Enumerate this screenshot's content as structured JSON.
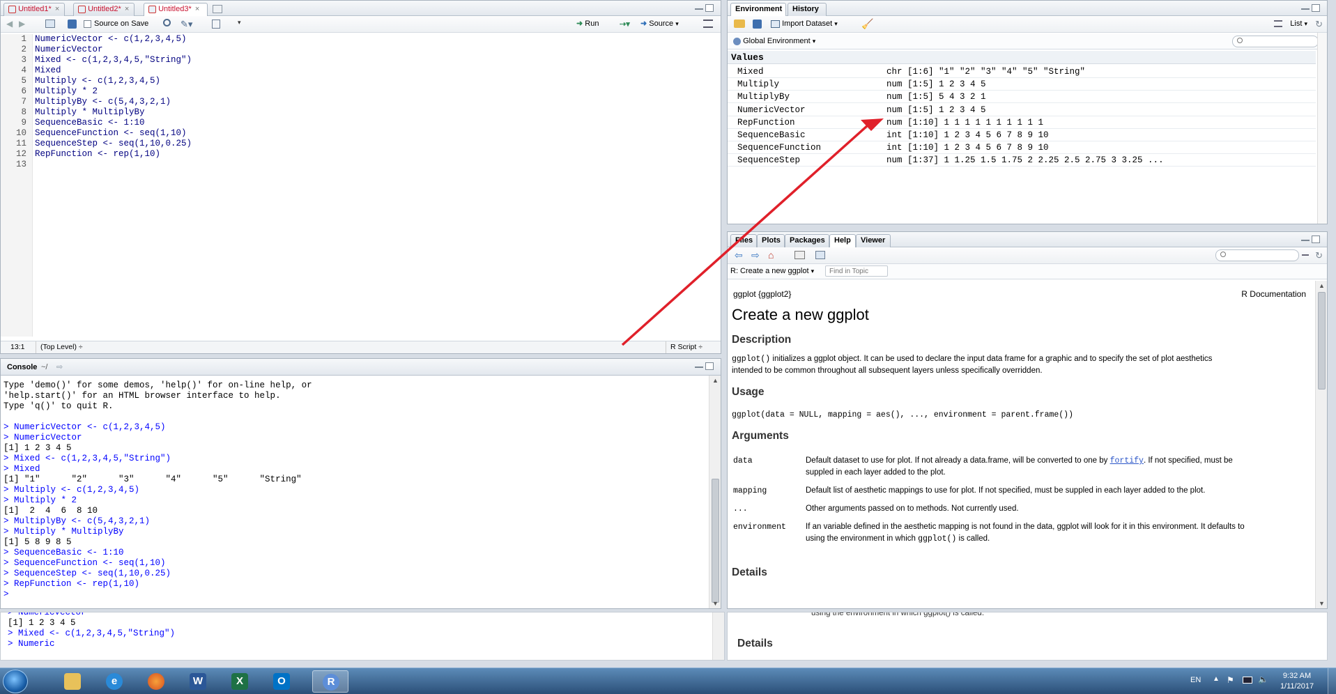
{
  "editor": {
    "tabs": [
      {
        "label": "Untitled1*"
      },
      {
        "label": "Untitled2*"
      },
      {
        "label": "Untitled3*"
      }
    ],
    "source_on_save": "Source on Save",
    "run_label": "Run",
    "source_label": "Source",
    "line_numbers": [
      "1",
      "2",
      "3",
      "4",
      "5",
      "6",
      "7",
      "8",
      "9",
      "10",
      "11",
      "12",
      "13"
    ],
    "lines": [
      "NumericVector <- c(1,2,3,4,5)",
      "NumericVector",
      "Mixed <- c(1,2,3,4,5,\"String\")",
      "Mixed",
      "Multiply <- c(1,2,3,4,5)",
      "Multiply * 2",
      "MultiplyBy <- c(5,4,3,2,1)",
      "Multiply * MultiplyBy",
      "SequenceBasic <- 1:10",
      "SequenceFunction <- seq(1,10)",
      "SequenceStep <- seq(1,10,0.25)",
      "RepFunction <- rep(1,10)",
      ""
    ],
    "status_pos": "13:1",
    "status_scope": "(Top Level) ÷",
    "status_type": "R Script ÷"
  },
  "console": {
    "title": "Console",
    "path": "~/",
    "lines": [
      {
        "t": "out",
        "s": "Type 'demo()' for some demos, 'help()' for on-line help, or"
      },
      {
        "t": "out",
        "s": "'help.start()' for an HTML browser interface to help."
      },
      {
        "t": "out",
        "s": "Type 'q()' to quit R."
      },
      {
        "t": "out",
        "s": ""
      },
      {
        "t": "in",
        "s": "> NumericVector <- c(1,2,3,4,5)"
      },
      {
        "t": "in",
        "s": "> NumericVector"
      },
      {
        "t": "out",
        "s": "[1] 1 2 3 4 5"
      },
      {
        "t": "in",
        "s": "> Mixed <- c(1,2,3,4,5,\"String\")"
      },
      {
        "t": "in",
        "s": "> Mixed"
      },
      {
        "t": "out",
        "s": "[1] \"1\"      \"2\"      \"3\"      \"4\"      \"5\"      \"String\""
      },
      {
        "t": "in",
        "s": "> Multiply <- c(1,2,3,4,5)"
      },
      {
        "t": "in",
        "s": "> Multiply * 2"
      },
      {
        "t": "out",
        "s": "[1]  2  4  6  8 10"
      },
      {
        "t": "in",
        "s": "> MultiplyBy <- c(5,4,3,2,1)"
      },
      {
        "t": "in",
        "s": "> Multiply * MultiplyBy"
      },
      {
        "t": "out",
        "s": "[1] 5 8 9 8 5"
      },
      {
        "t": "in",
        "s": "> SequenceBasic <- 1:10"
      },
      {
        "t": "in",
        "s": "> SequenceFunction <- seq(1,10)"
      },
      {
        "t": "in",
        "s": "> SequenceStep <- seq(1,10,0.25)"
      },
      {
        "t": "in",
        "s": "> RepFunction <- rep(1,10)"
      },
      {
        "t": "in",
        "s": "> "
      }
    ]
  },
  "ghost_console": [
    "> NumericVector",
    "[1] 1 2 3 4 5",
    "> Mixed <- c(1,2,3,4,5,\"String\")",
    "> Numeric"
  ],
  "environment": {
    "tabs": [
      "Environment",
      "History"
    ],
    "import_label": "Import Dataset",
    "view_label": "List",
    "scope_label": "Global Environment",
    "section": "Values",
    "rows": [
      {
        "name": "Mixed",
        "value": "chr [1:6] \"1\" \"2\" \"3\" \"4\" \"5\" \"String\""
      },
      {
        "name": "Multiply",
        "value": "num [1:5] 1 2 3 4 5"
      },
      {
        "name": "MultiplyBy",
        "value": "num [1:5] 5 4 3 2 1"
      },
      {
        "name": "NumericVector",
        "value": "num [1:5] 1 2 3 4 5"
      },
      {
        "name": "RepFunction",
        "value": "num [1:10] 1 1 1 1 1 1 1 1 1 1"
      },
      {
        "name": "SequenceBasic",
        "value": "int [1:10] 1 2 3 4 5 6 7 8 9 10"
      },
      {
        "name": "SequenceFunction",
        "value": "int [1:10] 1 2 3 4 5 6 7 8 9 10"
      },
      {
        "name": "SequenceStep",
        "value": "num [1:37] 1 1.25 1.5 1.75 2 2.25 2.5 2.75 3 3.25 ..."
      }
    ]
  },
  "help": {
    "tabs": [
      "Files",
      "Plots",
      "Packages",
      "Help",
      "Viewer"
    ],
    "topic_label": "R: Create a new ggplot",
    "find_placeholder": "Find in Topic",
    "pkg": "ggplot {ggplot2}",
    "rdoc": "R Documentation",
    "title": "Create a new ggplot",
    "description_h": "Description",
    "description_code": "ggplot()",
    "description_text_1": " initializes a ggplot object. It can be used to declare the input data frame for a graphic and to specify the set of plot aesthetics",
    "description_text_2": "intended to be common throughout all subsequent layers unless specifically overridden.",
    "usage_h": "Usage",
    "usage": "ggplot(data = NULL, mapping = aes(), ..., environment = parent.frame())",
    "arguments_h": "Arguments",
    "args": [
      {
        "name": "data",
        "desc1_a": "Default dataset to use for plot. If not already a data.frame, will be converted to one by ",
        "desc1_link": "fortify",
        "desc1_b": ". If not specified, must be",
        "desc2": "suppled in each layer added to the plot."
      },
      {
        "name": "mapping",
        "desc1_a": "Default list of aesthetic mappings to use for plot. If not specified, must be suppled in each layer added to the plot.",
        "desc1_link": "",
        "desc1_b": "",
        "desc2": ""
      },
      {
        "name": "...",
        "desc1_a": "Other arguments passed on to methods. Not currently used.",
        "desc1_link": "",
        "desc1_b": "",
        "desc2": ""
      },
      {
        "name": "environment",
        "desc1_a": "If an variable defined in the aesthetic mapping is not found in the data, ggplot will look for it in this environment. It defaults to",
        "desc1_link": "",
        "desc1_b": "",
        "desc2a": "using the environment in which ",
        "desc2code": "ggplot()",
        "desc2b": " is called."
      }
    ],
    "details_h": "Details",
    "ghost_text": "using the environment in which ggplot() is called.",
    "ghost_details": "Details"
  },
  "taskbar": {
    "lang": "EN",
    "time": "9:32 AM",
    "date": "1/11/2017"
  },
  "colors": {
    "annotation_arrow": "#e0202a",
    "code_blue": "#0000ff",
    "tab_red": "#c8102e"
  }
}
